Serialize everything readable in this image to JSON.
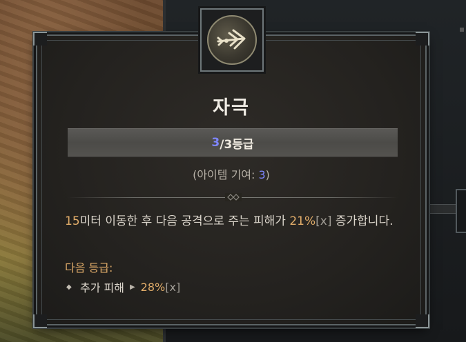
{
  "skill": {
    "title": "자극",
    "rank_current": "3",
    "rank_suffix": "/3등급",
    "item_bonus_prefix": "(아이템 기여: ",
    "item_bonus_value": "3",
    "item_bonus_suffix": ")"
  },
  "description": {
    "distance": "15",
    "part1": "미터 이동한 후 다음 공격으로 주는 피해가 ",
    "percent": "21%",
    "xtag": "[x]",
    "part2": " 증가합니다."
  },
  "next_rank": {
    "label": "다음 등급:",
    "stat_label": "추가 피해",
    "stat_value": "28%",
    "xtag": "[x]"
  },
  "icon": "arrow-skill-icon",
  "colors": {
    "gold": "#e2ad6a",
    "rank_blue": "#7f86ff",
    "text": "#dcd6cc"
  }
}
